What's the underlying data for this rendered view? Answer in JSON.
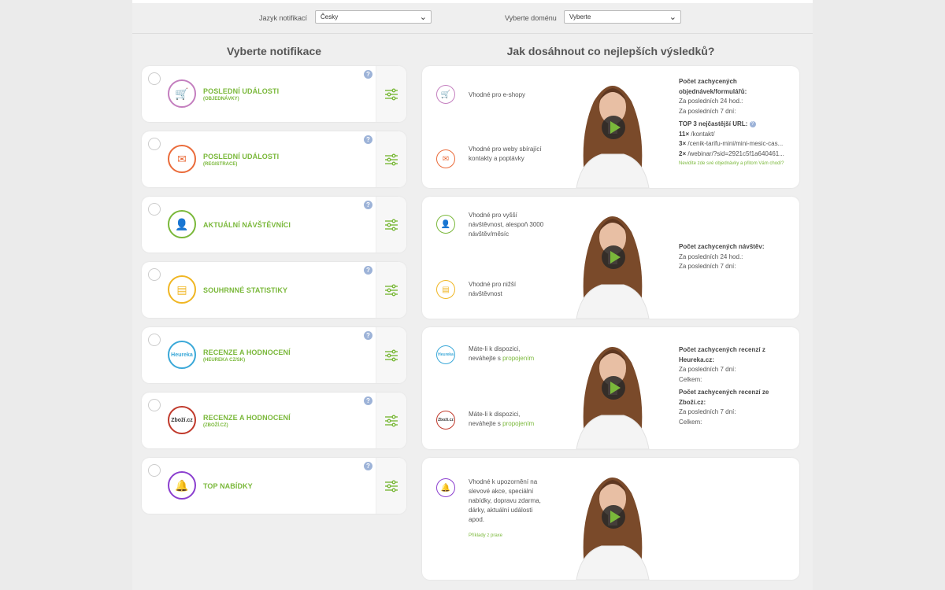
{
  "filters": {
    "language_label": "Jazyk notifikací",
    "language_value": "Česky",
    "domain_label": "Vyberte doménu",
    "domain_value": "Vyberte"
  },
  "left_heading": "Vyberte notifikace",
  "right_heading": "Jak dosáhnout co nejlepších výsledků?",
  "notifications": [
    {
      "title": "POSLEDNÍ UDÁLOSTI",
      "subtitle": "(OBJEDNÁVKY)",
      "icon": "cart-icon",
      "color": "#c47fbf"
    },
    {
      "title": "POSLEDNÍ UDÁLOSTI",
      "subtitle": "(REGISTRACE)",
      "icon": "envelope-icon",
      "color": "#ea6b3a"
    },
    {
      "title": "AKTUÁLNÍ NÁVŠTĚVNÍCI",
      "subtitle": "",
      "icon": "visitor-icon",
      "color": "#7ab83a"
    },
    {
      "title": "SOUHRNNÉ STATISTIKY",
      "subtitle": "",
      "icon": "stats-icon",
      "color": "#f0b623"
    },
    {
      "title": "RECENZE A HODNOCENÍ",
      "subtitle": "(HEUREKA CZ/SK)",
      "icon": "heureka-logo-icon",
      "color": "#3aa8d8"
    },
    {
      "title": "RECENZE A HODNOCENÍ",
      "subtitle": "(ZBOŽÍ.CZ)",
      "icon": "zbozi-logo-icon",
      "color": "#c0392b"
    },
    {
      "title": "TOP NABÍDKY",
      "subtitle": "",
      "icon": "bell-icon",
      "color": "#8b3fcf"
    }
  ],
  "help_glyph": "?",
  "heureka_logo_text": "Heureka",
  "zbozi_logo_text": "Zboží.cz",
  "guides": [
    {
      "items": [
        {
          "icon": "cart-icon",
          "color": "#c47fbf",
          "text": "Vhodné pro e-shopy"
        },
        {
          "icon": "envelope-icon",
          "color": "#ea6b3a",
          "text": "Vhodné pro weby sbírající kontakty a poptávky"
        }
      ],
      "stats": {
        "heading1": "Počet zachycených objednávek/formulářů:",
        "line1": "Za posledních 24 hod.:",
        "line2": "Za posledních 7 dní:",
        "heading2": "TOP 3 nejčastější URL:",
        "urls": [
          {
            "count": "11×",
            "url": "/kontakt/"
          },
          {
            "count": "3×",
            "url": "/cenik-tarifu-mini/mini-mesic-cas..."
          },
          {
            "count": "2×",
            "url": "/webinar/?sid=2921c5f1a640461..."
          }
        ],
        "note": "Nevidíte zde své objednávky a přitom Vám chodí?"
      }
    },
    {
      "items": [
        {
          "icon": "visitor-icon",
          "color": "#7ab83a",
          "text": "Vhodné pro vyšší návštěvnost, alespoň 3000 návštěv/měsíc"
        },
        {
          "icon": "stats-icon",
          "color": "#f0b623",
          "text": "Vhodné pro nižší návštěvnost"
        }
      ],
      "stats": {
        "heading1": "Počet zachycených návštěv:",
        "line1": "Za posledních 24 hod.:",
        "line2": "Za posledních 7 dní:"
      }
    },
    {
      "items": [
        {
          "icon": "heureka-logo-icon",
          "color": "#3aa8d8",
          "text_before": "Máte-li k dispozici, neváhejte s",
          "link": "propojením"
        },
        {
          "icon": "zbozi-logo-icon",
          "color": "#c0392b",
          "text_before": "Máte-li k dispozici, neváhejte s",
          "link": "propojením"
        }
      ],
      "stats": {
        "heading1": "Počet zachycených recenzí z Heureka.cz:",
        "line1": "Za posledních 7 dní:",
        "line2": "Celkem:",
        "heading2": "Počet zachycených recenzí ze Zboží.cz:",
        "line3": "Za posledních 7 dní:",
        "line4": "Celkem:"
      }
    },
    {
      "items": [
        {
          "icon": "bell-icon",
          "color": "#8b3fcf",
          "text": "Vhodné k upozornění na slevové akce, speciální nabídky, dopravu zdarma, dárky, aktuální události apod."
        }
      ],
      "link": "Příklady z praxe"
    }
  ],
  "colors": {
    "accent_green": "#7ab83a"
  }
}
